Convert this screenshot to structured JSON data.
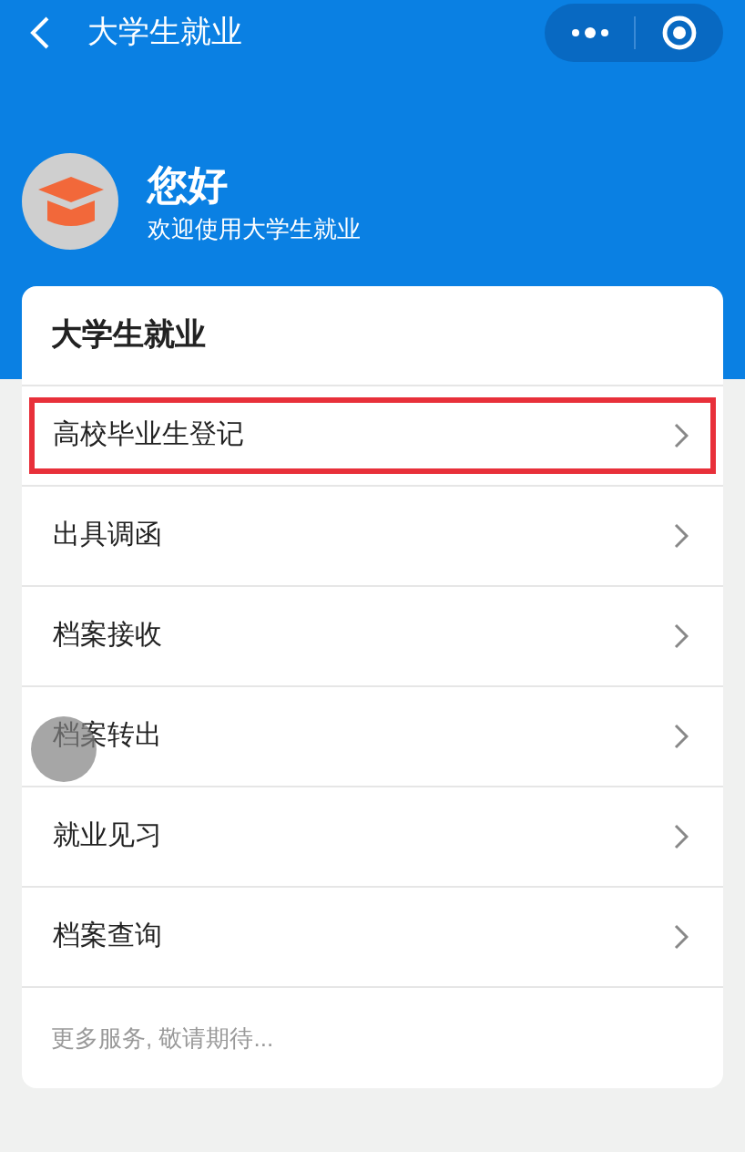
{
  "nav_bar": {
    "title": "大学生就业"
  },
  "profile": {
    "greeting": "您好",
    "subtitle": "欢迎使用大学生就业"
  },
  "card": {
    "title": "大学生就业",
    "items": [
      {
        "label": "高校毕业生登记",
        "highlighted": true
      },
      {
        "label": "出具调函",
        "highlighted": false
      },
      {
        "label": "档案接收",
        "highlighted": false
      },
      {
        "label": "档案转出",
        "highlighted": false
      },
      {
        "label": "就业见习",
        "highlighted": false
      },
      {
        "label": "档案查询",
        "highlighted": false
      }
    ],
    "footer": "更多服务, 敬请期待..."
  }
}
